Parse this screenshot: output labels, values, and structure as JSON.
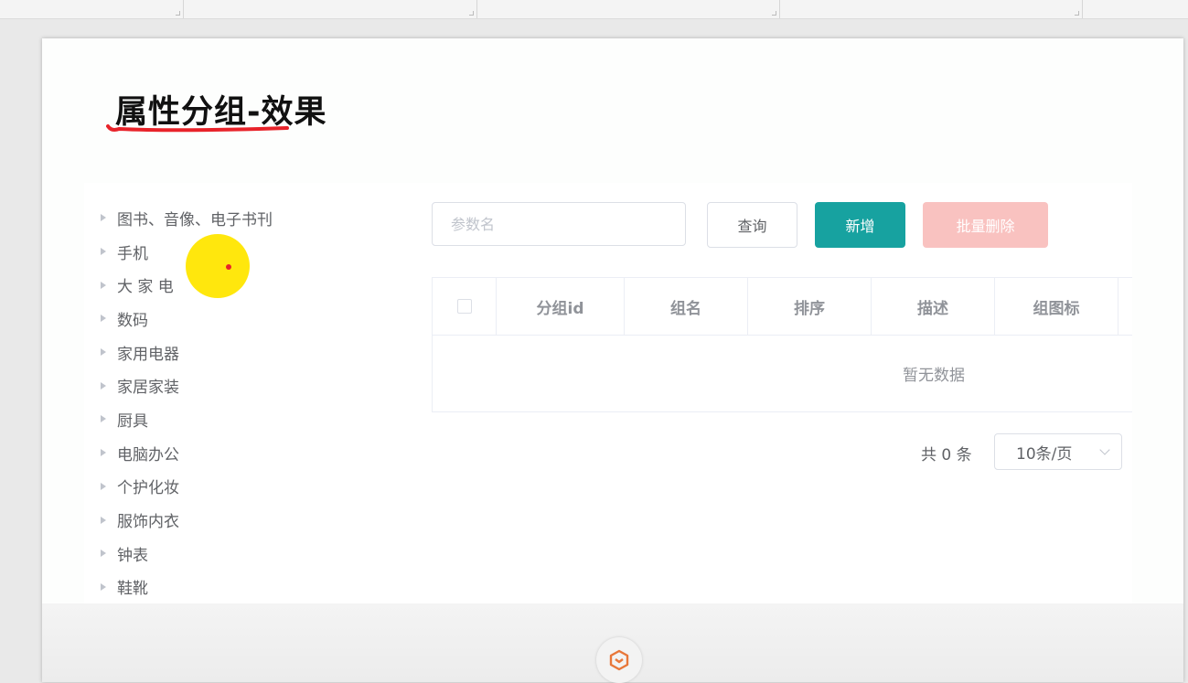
{
  "slide": {
    "title": "属性分组-效果"
  },
  "tree": {
    "items": [
      "图书、音像、电子书刊",
      "手机",
      "大 家 电",
      "数码",
      "家用电器",
      "家居家装",
      "厨具",
      "电脑办公",
      "个护化妆",
      "服饰内衣",
      "钟表",
      "鞋靴"
    ]
  },
  "toolbar": {
    "search_placeholder": "参数名",
    "query_label": "查询",
    "add_label": "新增",
    "batch_delete_label": "批量删除"
  },
  "table": {
    "columns": [
      "分组id",
      "组名",
      "排序",
      "描述",
      "组图标"
    ],
    "empty_text": "暂无数据"
  },
  "pagination": {
    "total_text": "共 0 条",
    "page_size": "10条/页"
  },
  "colors": {
    "primary": "#17a2a0",
    "danger_disabled": "#f9c2c0",
    "highlight": "#ffe600",
    "annotation": "#e8232a",
    "logo": "#e8773a"
  }
}
